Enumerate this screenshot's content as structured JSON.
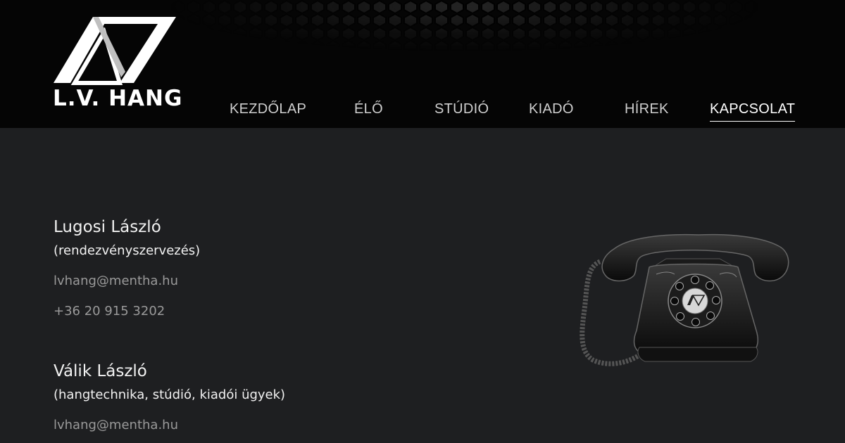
{
  "brand": {
    "name": "L.V. HANG"
  },
  "nav": {
    "items": [
      {
        "label": "KEZDŐLAP",
        "active": false
      },
      {
        "label": "ÉLŐ",
        "active": false
      },
      {
        "label": "STÚDIÓ",
        "active": false
      },
      {
        "label": "KIADÓ",
        "active": false
      },
      {
        "label": "HÍREK",
        "active": false
      },
      {
        "label": "KAPCSOLAT",
        "active": true
      }
    ]
  },
  "contacts": [
    {
      "name": "Lugosi László",
      "role": "(rendezvényszervezés)",
      "email": "lvhang@mentha.hu",
      "phone": "+36 20 915 3202"
    },
    {
      "name": "Válik László",
      "role": "(hangtechnika, stúdió, kiadói ügyek)",
      "email": "lvhang@mentha.hu"
    }
  ],
  "images": {
    "telephone": "rotary-telephone-icon"
  },
  "colors": {
    "header_bg": "#050505",
    "page_bg": "#1e1f21",
    "text": "#f2f2f2",
    "muted": "#9a9a9a"
  }
}
